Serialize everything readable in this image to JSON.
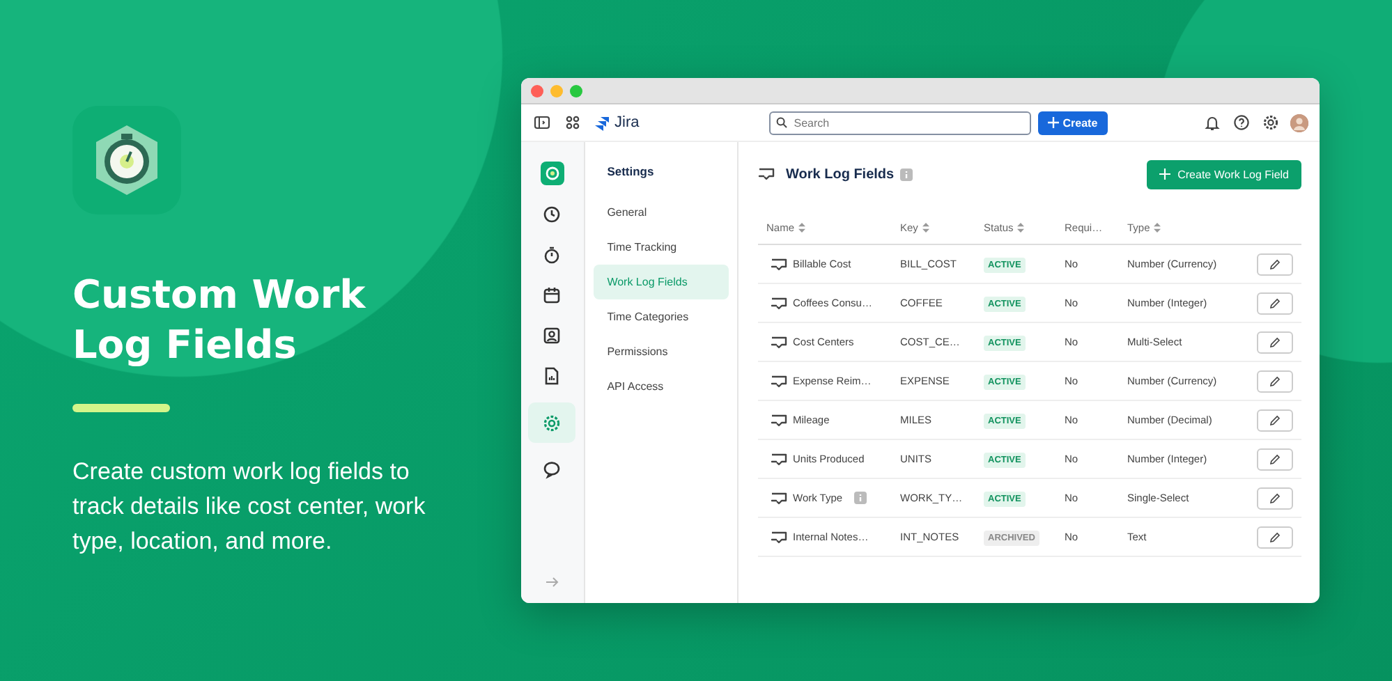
{
  "promo": {
    "headline": "Custom Work Log Fields",
    "description": "Create custom work log fields to track details like cost center, work type, location, and more."
  },
  "topbar": {
    "product": "Jira",
    "search": {
      "placeholder": "Search"
    },
    "create_button": "Create"
  },
  "rail": [
    {
      "selected": false
    },
    {
      "selected": false
    },
    {
      "selected": false
    },
    {
      "selected": false
    },
    {
      "selected": false
    },
    {
      "selected": true
    },
    {
      "selected": false
    }
  ],
  "settings_nav": {
    "title": "Settings",
    "items": [
      {
        "label": "General",
        "selected": false
      },
      {
        "label": "Time Tracking",
        "selected": false
      },
      {
        "label": "Work Log Fields",
        "selected": true
      },
      {
        "label": "Time Categories",
        "selected": false
      },
      {
        "label": "Permissions",
        "selected": false
      },
      {
        "label": "API Access",
        "selected": false
      }
    ]
  },
  "page": {
    "title": "Work Log Fields",
    "action_button": "Create Work Log Field"
  },
  "table": {
    "columns": [
      {
        "label": "Name",
        "sortable": true
      },
      {
        "label": "Key",
        "sortable": true
      },
      {
        "label": "Status",
        "sortable": true
      },
      {
        "label": "Requi…",
        "sortable": false
      },
      {
        "label": "Type",
        "sortable": true
      }
    ],
    "rows": [
      {
        "name": "Billable Cost",
        "info": false,
        "key": "BILL_COST",
        "status": "ACTIVE",
        "kind": "active",
        "required": "No",
        "type": "Number (Currency)"
      },
      {
        "name": "Coffees Consu…",
        "info": false,
        "key": "COFFEE",
        "status": "ACTIVE",
        "kind": "active",
        "required": "No",
        "type": "Number (Integer)"
      },
      {
        "name": "Cost Centers",
        "info": false,
        "key": "COST_CE…",
        "status": "ACTIVE",
        "kind": "active",
        "required": "No",
        "type": "Multi-Select"
      },
      {
        "name": "Expense Reim…",
        "info": false,
        "key": "EXPENSE",
        "status": "ACTIVE",
        "kind": "active",
        "required": "No",
        "type": "Number (Currency)"
      },
      {
        "name": "Mileage",
        "info": false,
        "key": "MILES",
        "status": "ACTIVE",
        "kind": "active",
        "required": "No",
        "type": "Number (Decimal)"
      },
      {
        "name": "Units Produced",
        "info": false,
        "key": "UNITS",
        "status": "ACTIVE",
        "kind": "active",
        "required": "No",
        "type": "Number (Integer)"
      },
      {
        "name": "Work Type",
        "info": true,
        "key": "WORK_TY…",
        "status": "ACTIVE",
        "kind": "active",
        "required": "No",
        "type": "Single-Select"
      },
      {
        "name": "Internal Notes…",
        "info": false,
        "key": "INT_NOTES",
        "status": "ARCHIVED",
        "kind": "archived",
        "required": "No",
        "type": "Text"
      }
    ]
  }
}
